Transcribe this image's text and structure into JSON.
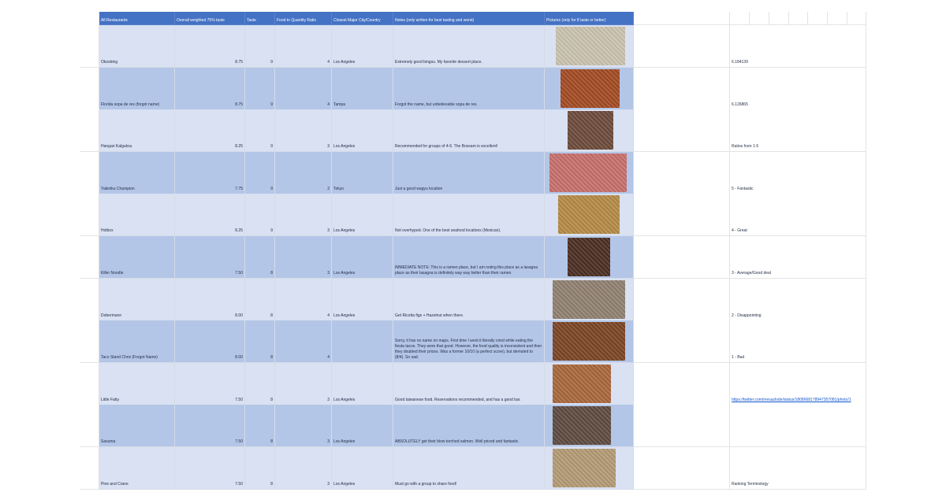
{
  "sheet": {
    "headers": [
      "All Restaurants",
      "Overall weighted 75% taste",
      "Taste",
      "Food to Quantity Ratio",
      "Closest Major City/Country",
      "Notes (only written for best tasting and worst)",
      "Pictures (only for 8 taste or better)"
    ],
    "rows": [
      {
        "name": "Okosbing",
        "overall": "8.75",
        "taste": "9",
        "ratio": "4",
        "city": "Los Angeles",
        "notes": "Extremely good bingsu. My favorite dessert place.",
        "side": "6.184139",
        "pic_color": "#c9c2ae"
      },
      {
        "name": "Florida sopa de res (forgot name)",
        "overall": "8.75",
        "taste": "9",
        "ratio": "4",
        "city": "Tampa",
        "notes": "Forgot the name, but unbelievable sopa de res.",
        "side": "6.126865",
        "pic_color": "#a24a22"
      },
      {
        "name": "Hangari Kalguksu",
        "overall": "8.25",
        "taste": "9",
        "ratio": "3",
        "city": "Los Angeles",
        "notes": "Recommended for groups of 4-6. The Bossam is excellent!",
        "side": "Ratios from 1-5",
        "pic_color": "#6b4a3a"
      },
      {
        "name": "Yakiniku Champion",
        "overall": "7.75",
        "taste": "9",
        "ratio": "2",
        "city": "Tokyo",
        "notes": "Just a good wagyu location",
        "side": "5 - Fantastic",
        "pic_color": "#c66f6b"
      },
      {
        "name": "Holbox",
        "overall": "8.25",
        "taste": "9",
        "ratio": "3",
        "city": "Los Angeles",
        "notes": "Not overhyped. One of the best seafood locations (Mexican).",
        "side": "4 - Great",
        "pic_color": "#b48a45"
      },
      {
        "name": "Killer Noodle",
        "overall": "7.50",
        "taste": "8",
        "ratio": "3",
        "city": "Los Angeles",
        "notes": "IMMEDIATE NOTE: This is a ramen place, but I am noting this place as a lasagna place as their lasagna is definitely way way better than their ramen.",
        "side": "3 - Average/Good deal",
        "pic_color": "#4a2e22"
      },
      {
        "name": "Dobermann",
        "overall": "8.00",
        "taste": "8",
        "ratio": "4",
        "city": "Los Angeles",
        "notes": "Get Ricotta figs + Hazelnut when there.",
        "side": "2 - Disappointing",
        "pic_color": "#8f8071"
      },
      {
        "name": "Taco Stand Chris (Forgot Name)",
        "overall": "8.00",
        "taste": "8",
        "ratio": "4",
        "city": "",
        "notes": "Sorry, it has no name on maps. First time I went it literally cried while eating the fiesta tacos. They were that good. However, the food quality is inconsistent and then they doubled their prices. Was a former 10/10 (a perfect score), but demoted to (8/4). So sad.",
        "side": "1 - Bad",
        "pic_color": "#7a4424"
      },
      {
        "name": "Little Fatty",
        "overall": "7.50",
        "taste": "8",
        "ratio": "3",
        "city": "Los Angeles",
        "notes": "Good taiwanese food. Reservations recommended, and has a good bar.",
        "side": "https://twitter.com/mesazlode/status/1808668178947357081/photo/1",
        "side_link": true,
        "pic_color": "#a8673c"
      },
      {
        "name": "Sasuma",
        "overall": "7.50",
        "taste": "8",
        "ratio": "3",
        "city": "Los Angeles",
        "notes": "ABSOLUTELY get their blow torched salmon. Well priced and fantastic.",
        "side": "",
        "pic_color": "#5d4a40"
      },
      {
        "name": "Pine and Crane",
        "overall": "7.50",
        "taste": "8",
        "ratio": "3",
        "city": "Los Angeles",
        "notes": "Must go with a group to share food!",
        "side": "Ranking Terminology",
        "pic_color": "#b39a74"
      }
    ]
  }
}
